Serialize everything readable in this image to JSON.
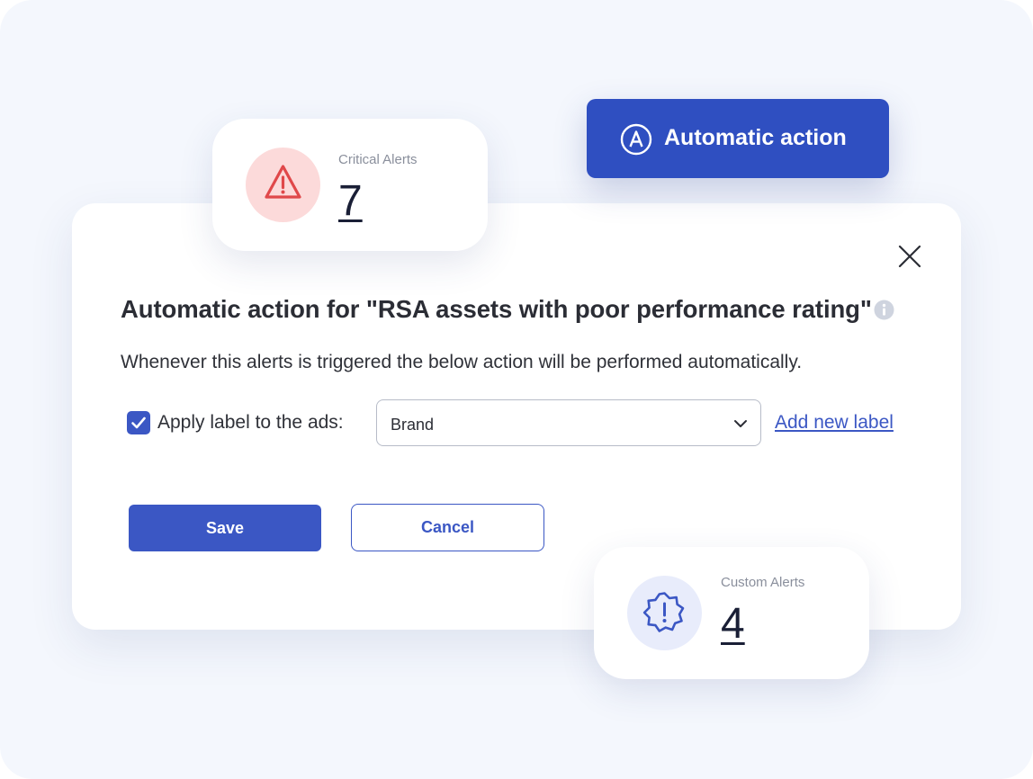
{
  "dialog": {
    "title": "Automatic action for \"RSA assets with poor performance rating\"",
    "description": "Whenever this alerts is triggered the below action will be performed automatically.",
    "apply_label": "Apply label to the ads:",
    "apply_checked": true,
    "select_value": "Brand",
    "add_label_link": "Add new label",
    "save_label": "Save",
    "cancel_label": "Cancel",
    "icons": {
      "close": "close-icon",
      "info": "info-icon",
      "checkbox": "checkmark-icon",
      "select": "chevron-down-icon"
    }
  },
  "critical_card": {
    "label": "Critical Alerts",
    "count": "7",
    "icon": "warning-triangle-icon",
    "accent": "#e0484a"
  },
  "automatic_badge": {
    "label": "Automatic action",
    "icon": "circle-a-icon",
    "color": "#2f4fc1"
  },
  "custom_card": {
    "label": "Custom Alerts",
    "count": "4",
    "icon": "badge-alert-icon",
    "accent": "#3b57c4"
  },
  "colors": {
    "primary": "#3b57c4",
    "background": "#f4f7fd",
    "text": "#2b2d35"
  }
}
